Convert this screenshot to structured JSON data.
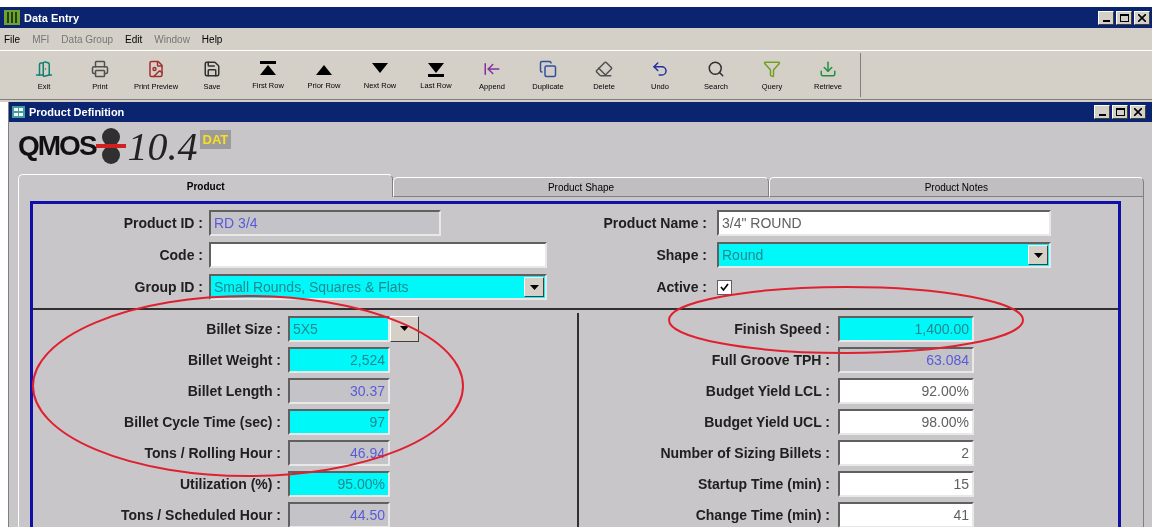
{
  "window": {
    "title": "Data Entry"
  },
  "menu": [
    {
      "label": "File",
      "disabled": false
    },
    {
      "label": "MFI",
      "disabled": true
    },
    {
      "label": "Data Group",
      "disabled": true
    },
    {
      "label": "Edit",
      "disabled": false
    },
    {
      "label": "Window",
      "disabled": true
    },
    {
      "label": "Help",
      "disabled": false
    }
  ],
  "toolbar": [
    {
      "label": "Exit"
    },
    {
      "label": "Print"
    },
    {
      "label": "Print Preview"
    },
    {
      "label": "Save"
    },
    {
      "label": "First Row"
    },
    {
      "label": "Prior Row"
    },
    {
      "label": "Next Row"
    },
    {
      "label": "Last Row"
    },
    {
      "label": "Append"
    },
    {
      "label": "Duplicate"
    },
    {
      "label": "Delete"
    },
    {
      "label": "Undo"
    },
    {
      "label": "Search"
    },
    {
      "label": "Query"
    },
    {
      "label": "Retrieve"
    }
  ],
  "child_window": {
    "title": "Product Definition"
  },
  "logo": {
    "name": "QMOS",
    "version": "10.4",
    "badge": "DAT"
  },
  "tabs": [
    {
      "label": "Product",
      "selected": true
    },
    {
      "label": "Product Shape",
      "selected": false
    },
    {
      "label": "Product Notes",
      "selected": false
    }
  ],
  "header_left": [
    {
      "label": "Product ID :",
      "value": "RD 3/4",
      "kind": "calculated",
      "dropdown": false
    },
    {
      "label": "Code :",
      "kind": "editable",
      "dropdown": false
    },
    {
      "label": "Group ID :",
      "value": "Small Rounds, Squares & Flats",
      "kind": "required",
      "dropdown": true
    }
  ],
  "header_right": [
    {
      "label": "Product Name :",
      "value": "3/4\" ROUND",
      "kind": "editable",
      "dropdown": false
    },
    {
      "label": "Shape :",
      "value": "Round",
      "kind": "required",
      "dropdown": true
    },
    {
      "label": "Active :",
      "kind": "checkbox",
      "checked": true
    }
  ],
  "left_fields": [
    {
      "label": "Billet Size :",
      "value": "5X5",
      "kind": "required",
      "dropdown": true
    },
    {
      "label": "Billet Weight :",
      "value": "2,524",
      "kind": "required",
      "dropdown": false
    },
    {
      "label": "Billet Length :",
      "value": "30.37",
      "kind": "calculated",
      "dropdown": false
    },
    {
      "label": "Billet Cycle Time (sec) :",
      "value": "97",
      "kind": "required",
      "dropdown": false
    },
    {
      "label": "Tons / Rolling Hour :",
      "value": "46.94",
      "kind": "calculated",
      "dropdown": false
    },
    {
      "label": "Utilization (%) :",
      "value": "95.00%",
      "kind": "required",
      "dropdown": false
    },
    {
      "label": "Tons / Scheduled Hour :",
      "value": "44.50",
      "kind": "calculated",
      "dropdown": false
    }
  ],
  "right_fields": [
    {
      "label": "Finish Speed :",
      "value": "1,400.00",
      "kind": "required",
      "dropdown": false
    },
    {
      "label": "Full Groove TPH :",
      "value": "63.084",
      "kind": "calculated",
      "dropdown": false
    },
    {
      "label": "Budget Yield LCL :",
      "value": "92.00%",
      "kind": "editable",
      "dropdown": false
    },
    {
      "label": "Budget Yield UCL :",
      "value": "98.00%",
      "kind": "editable",
      "dropdown": false
    },
    {
      "label": "Number of Sizing Billets :",
      "value": "2",
      "kind": "editable",
      "dropdown": false
    },
    {
      "label": "Startup Time (min) :",
      "value": "15",
      "kind": "editable",
      "dropdown": false
    },
    {
      "label": "Change Time (min) :",
      "value": "41",
      "kind": "editable",
      "dropdown": false
    }
  ]
}
